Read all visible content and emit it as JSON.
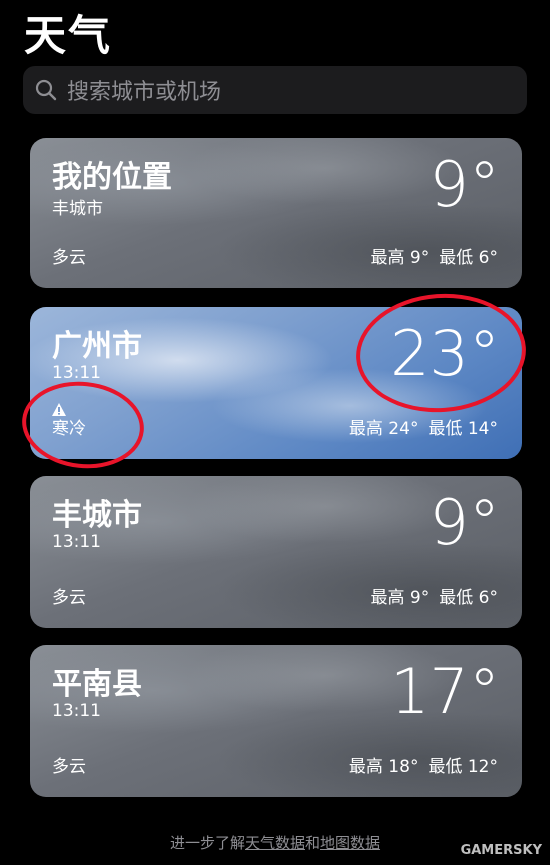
{
  "app": {
    "title": "天气"
  },
  "search": {
    "placeholder": "搜索城市或机场"
  },
  "cards": [
    {
      "name": "我的位置",
      "subtitle": "丰城市",
      "condition": "多云",
      "temperature": "9°",
      "high": "最高 9°",
      "low": "最低 6°",
      "theme": "grey"
    },
    {
      "name": "广州市",
      "subtitle": "13:11",
      "condition": "寒冷",
      "temperature": "23°",
      "high": "最高 24°",
      "low": "最低 14°",
      "theme": "blue",
      "alert_icon": "warning-triangle-icon"
    },
    {
      "name": "丰城市",
      "subtitle": "13:11",
      "condition": "多云",
      "temperature": "9°",
      "high": "最高 9°",
      "low": "最低 6°",
      "theme": "grey"
    },
    {
      "name": "平南县",
      "subtitle": "13:11",
      "condition": "多云",
      "temperature": "17°",
      "high": "最高 18°",
      "low": "最低 12°",
      "theme": "grey"
    }
  ],
  "footer": {
    "prefix": "进一步了解",
    "link_weather": "天气数据",
    "conjunction": "和",
    "link_map": "地图数据"
  },
  "watermark": {
    "text": "GAMERSKY"
  },
  "colors": {
    "annotation": "#e8142a",
    "background": "#000000",
    "search_bg": "#1c1c1e"
  }
}
